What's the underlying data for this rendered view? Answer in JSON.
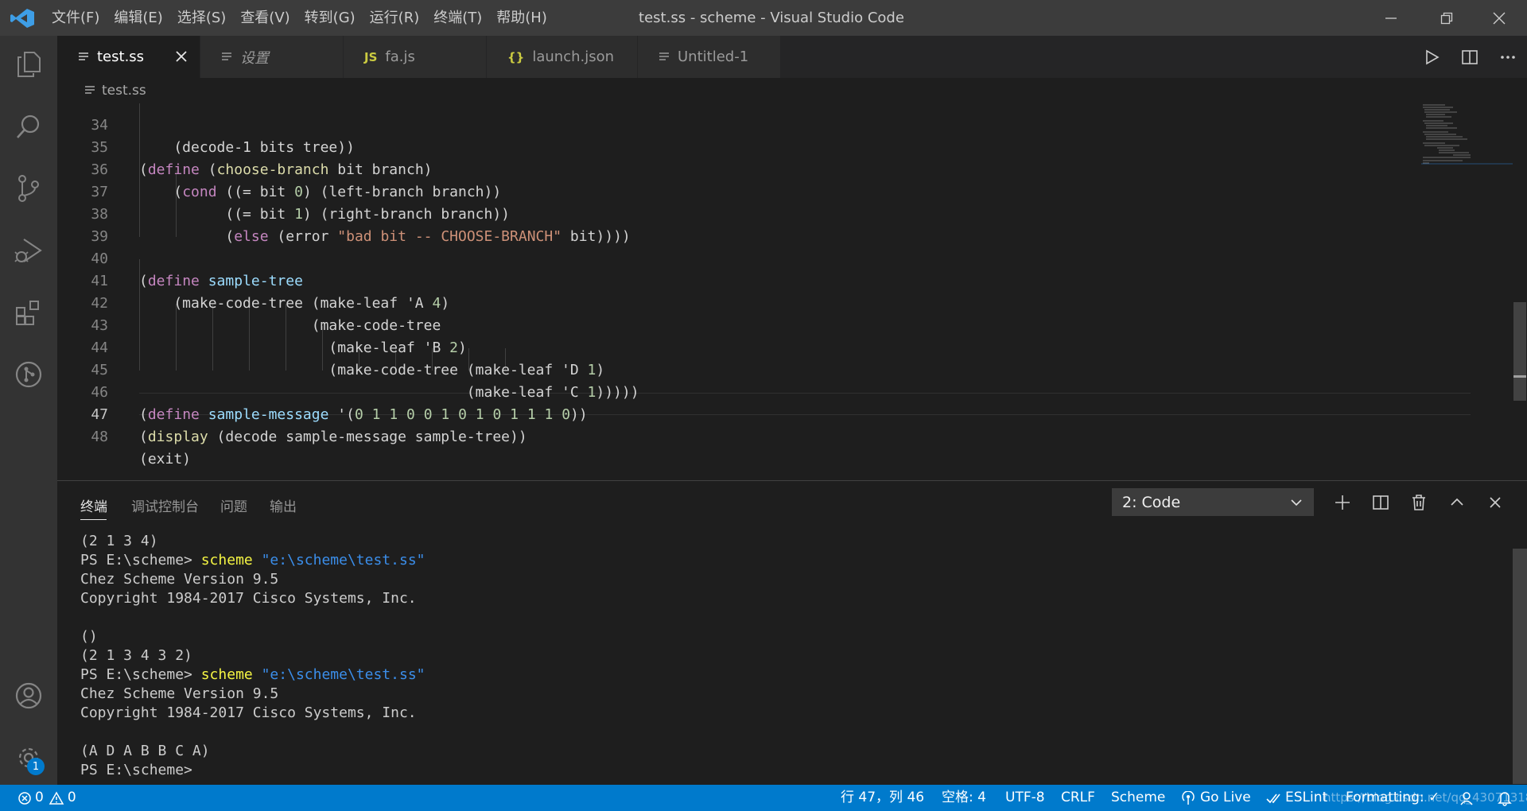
{
  "window": {
    "title": "test.ss - scheme - Visual Studio Code",
    "menus": [
      "文件(F)",
      "编辑(E)",
      "选择(S)",
      "查看(V)",
      "转到(G)",
      "运行(R)",
      "终端(T)",
      "帮助(H)"
    ]
  },
  "tabs": [
    {
      "label": "test.ss",
      "icon": "lines-icon"
    },
    {
      "label": "设置",
      "icon": "lines-icon"
    },
    {
      "label": "fa.js",
      "icon": "js-icon",
      "icon_text": "JS"
    },
    {
      "label": "launch.json",
      "icon": "json-icon",
      "icon_text": "{}"
    },
    {
      "label": "Untitled-1",
      "icon": "lines-icon"
    }
  ],
  "breadcrumb": {
    "file": "test.ss"
  },
  "editor": {
    "line_numbers": [
      "34",
      "35",
      "36",
      "37",
      "38",
      "39",
      "40",
      "41",
      "42",
      "43",
      "44",
      "45",
      "46",
      "47",
      "48"
    ],
    "current_line": "47",
    "lines": [
      "    (decode-1 bits tree))",
      "(define (choose-branch bit branch)",
      "    (cond ((= bit 0) (left-branch branch))",
      "          ((= bit 1) (right-branch branch))",
      "          (else (error \"bad bit -- CHOOSE-BRANCH\" bit))))",
      "",
      "(define sample-tree",
      "    (make-code-tree (make-leaf 'A 4)",
      "                    (make-code-tree",
      "                      (make-leaf 'B 2)",
      "                      (make-code-tree (make-leaf 'D 1)",
      "                                      (make-leaf 'C 1)))))",
      "(define sample-message '(0 1 1 0 0 1 0 1 0 1 1 1 0))",
      "(display (decode sample-message sample-tree))",
      "(exit)"
    ]
  },
  "panel": {
    "tabs": [
      "终端",
      "调试控制台",
      "问题",
      "输出"
    ],
    "active_tab": "终端",
    "terminal_select": "2: Code"
  },
  "terminal": {
    "lines": [
      {
        "text": "(2 1 3 4)"
      },
      {
        "prompt": "PS E:\\scheme> ",
        "cmd": "scheme",
        "arg": "\"e:\\scheme\\test.ss\""
      },
      {
        "text": "Chez Scheme Version 9.5"
      },
      {
        "text": "Copyright 1984-2017 Cisco Systems, Inc."
      },
      {
        "text": ""
      },
      {
        "text": "()"
      },
      {
        "text": "(2 1 3 4 3 2)"
      },
      {
        "prompt": "PS E:\\scheme> ",
        "cmd": "scheme",
        "arg": "\"e:\\scheme\\test.ss\""
      },
      {
        "text": "Chez Scheme Version 9.5"
      },
      {
        "text": "Copyright 1984-2017 Cisco Systems, Inc."
      },
      {
        "text": ""
      },
      {
        "text": "(A D A B B C A)"
      },
      {
        "text": "PS E:\\scheme> "
      }
    ]
  },
  "status": {
    "errors": "0",
    "warnings": "0",
    "position": "行 47，列 46",
    "spaces": "空格: 4",
    "encoding": "UTF-8",
    "eol": "CRLF",
    "language": "Scheme",
    "golive": "Go Live",
    "eslint": "ESLint",
    "formatting": "Formatting: ✓",
    "watermark": "https://blog.csdn.net/qq_43071318"
  },
  "activity_badge": "1",
  "colors": {
    "accent": "#007acc",
    "keyword": "#c586c0",
    "function": "#dcdcaa",
    "variable": "#9cdcfe",
    "number": "#b5cea8",
    "string": "#ce9178"
  }
}
